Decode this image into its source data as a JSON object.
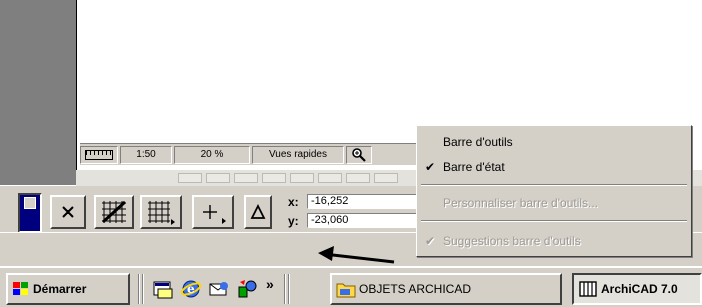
{
  "status_strip": {
    "scale": "1:50",
    "zoom": "20 %",
    "quick_views": "Vues rapides"
  },
  "toolbar": {
    "x_label": "x:",
    "x_value": "-16,252",
    "y_label": "y:",
    "y_value": "-23,060"
  },
  "context_menu": {
    "items": [
      {
        "label": "Barre d'outils",
        "checked": false,
        "enabled": true
      },
      {
        "label": "Barre d'état",
        "checked": true,
        "enabled": true
      },
      {
        "label": "Personnaliser barre d'outils...",
        "checked": false,
        "enabled": false
      },
      {
        "label": "Suggestions barre d'outils",
        "checked": true,
        "enabled": false
      }
    ],
    "check_glyph": "✔"
  },
  "taskbar": {
    "start_label": "Démarrer",
    "chevron": "»",
    "task1_label": "OBJETS ARCHICAD",
    "task2_label": "ArchiCAD 7.0"
  },
  "colors": {
    "face": "#d4d0c8",
    "gutter": "#7f7f7f",
    "selected_tool": "#00007f",
    "arrow": "#000000"
  }
}
